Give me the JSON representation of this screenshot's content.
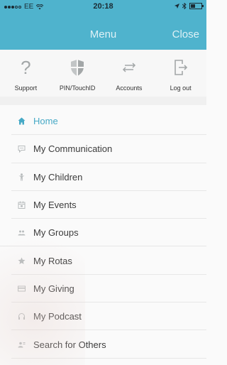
{
  "status_bar": {
    "carrier": "EE",
    "time": "20:18",
    "battery_level": 0.45
  },
  "header": {
    "title": "Menu",
    "close_label": "Close"
  },
  "quick_actions": [
    {
      "label": "Support",
      "icon": "question-icon"
    },
    {
      "label": "PIN/TouchID",
      "icon": "shield-icon"
    },
    {
      "label": "Accounts",
      "icon": "swap-arrows-icon"
    },
    {
      "label": "Log out",
      "icon": "logout-icon"
    }
  ],
  "menu": {
    "items": [
      {
        "label": "Home",
        "icon": "home-icon",
        "active": true
      },
      {
        "label": "My Communication",
        "icon": "chat-icon"
      },
      {
        "label": "My Children",
        "icon": "child-icon"
      },
      {
        "label": "My Events",
        "icon": "calendar-icon"
      },
      {
        "label": "My Groups",
        "icon": "group-icon"
      },
      {
        "label": "My Rotas",
        "icon": "star-icon"
      },
      {
        "label": "My Giving",
        "icon": "card-icon"
      },
      {
        "label": "My Podcast",
        "icon": "headphones-icon"
      },
      {
        "label": "Search for Others",
        "icon": "search-people-icon"
      }
    ]
  },
  "colors": {
    "header_bg": "#4fb3cd",
    "active": "#46a9c6",
    "icon_gray": "#b8bcbd"
  }
}
